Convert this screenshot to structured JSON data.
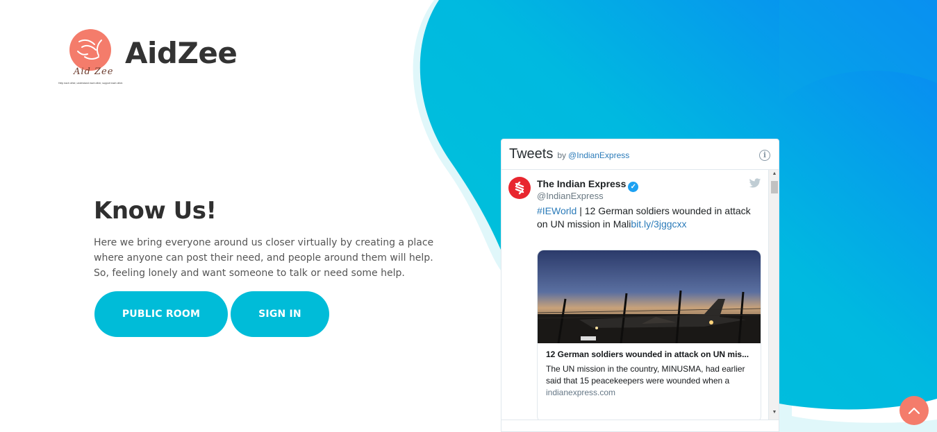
{
  "brand": {
    "name": "AidZee",
    "logo_script": "Aid Zee",
    "logo_tagline": "Help each other, understand each other, support each other.",
    "logo_icon": "helping-hands-logo"
  },
  "hero": {
    "title": "Know Us!",
    "description": "Here we bring everyone around us closer virtually by creating a place where anyone can post their need, and people around them will help. So, feeling lonely and want someone to talk or need some help.",
    "buttons": {
      "public_room": "PUBLIC ROOM",
      "sign_in": "SIGN IN"
    }
  },
  "tweets_widget": {
    "title": "Tweets",
    "by": "by",
    "account": "@IndianExpress",
    "info_icon": "info-icon",
    "tweet": {
      "user_name": "The Indian Express",
      "verified_icon": "verified-badge-icon",
      "handle": "@IndianExpress",
      "hashtag": "#IEWorld",
      "text": " | 12 German soldiers wounded in attack on UN mission in Mali",
      "link": "bit.ly/3jggcxx",
      "platform_icon": "twitter-bird-icon",
      "card": {
        "title": "12 German soldiers wounded in attack on UN mis...",
        "description": "The UN mission in the country, MINUSMA, had earlier said that 15 peacekeepers were wounded when a",
        "domain": "indianexpress.com"
      }
    }
  },
  "back_to_top": {
    "icon": "chevron-up-icon"
  },
  "colors": {
    "accent": "#00bcd8",
    "logo_coral": "#f47c6b",
    "blob_start": "#00c6d7",
    "blob_end": "#0a84f5",
    "text_dark": "#333333",
    "twitter_link": "#2b7bb9"
  }
}
